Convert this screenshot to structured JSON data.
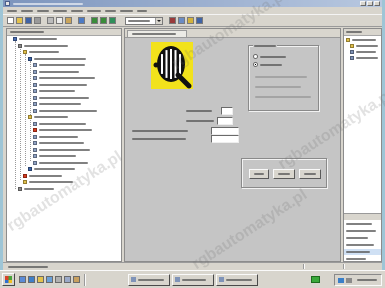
{
  "watermark": {
    "text": "rgbautomatyka.pl"
  },
  "colors": {
    "desktop_frame": "#9ec5d6",
    "title_bar": "#7d95bd",
    "chrome": "#d8d5cd",
    "editor_bg": "#c5c5c5",
    "safety_icon_yellow": "#f2e21c",
    "status_green": "#3aa83a",
    "tree_warning_icon": "#d83a1e"
  },
  "toolbar": {
    "icons_left": [
      "new-document-icon",
      "open-folder-icon",
      "save-icon",
      "print-icon",
      "cut-icon",
      "copy-icon",
      "paste-icon",
      "undo-icon",
      "download-icon",
      "upload-icon",
      "go-online-icon"
    ],
    "icons_right": [
      "go-offline-icon",
      "zoom-icon",
      "diagnostics-icon",
      "help-icon"
    ]
  },
  "tree": {
    "items": [
      {
        "level": 0,
        "icon": "project-icon"
      },
      {
        "level": 1,
        "icon": "station-icon"
      },
      {
        "level": 2,
        "icon": "folder-icon"
      },
      {
        "level": 3,
        "icon": "device-icon"
      },
      {
        "level": 4,
        "icon": "module-icon"
      },
      {
        "level": 4,
        "icon": "module-icon"
      },
      {
        "level": 4,
        "icon": "module-icon"
      },
      {
        "level": 4,
        "icon": "module-icon"
      },
      {
        "level": 4,
        "icon": "module-icon"
      },
      {
        "level": 4,
        "icon": "module-icon"
      },
      {
        "level": 4,
        "icon": "module-icon"
      },
      {
        "level": 4,
        "icon": "module-icon"
      },
      {
        "level": 3,
        "icon": "folder-icon"
      },
      {
        "level": 4,
        "icon": "module-icon"
      },
      {
        "level": 4,
        "icon": "module-error-icon"
      },
      {
        "level": 4,
        "icon": "module-icon"
      },
      {
        "level": 4,
        "icon": "module-icon"
      },
      {
        "level": 4,
        "icon": "module-icon"
      },
      {
        "level": 4,
        "icon": "module-icon"
      },
      {
        "level": 4,
        "icon": "module-icon"
      },
      {
        "level": 3,
        "icon": "device-icon"
      },
      {
        "level": 2,
        "icon": "module-error-icon"
      },
      {
        "level": 2,
        "icon": "folder-icon"
      },
      {
        "level": 1,
        "icon": "station-icon"
      }
    ]
  },
  "catalog": {
    "items": [
      {
        "level": 0,
        "icon": "catalog-folder-icon"
      },
      {
        "level": 1,
        "icon": "catalog-folder-icon"
      },
      {
        "level": 1,
        "icon": "catalog-device-icon"
      },
      {
        "level": 1,
        "icon": "catalog-device-icon"
      }
    ]
  },
  "editor": {
    "device_icon": "safety-device-icon"
  },
  "taskbar": {
    "start_icon": "start-icon",
    "quick_launch_icons": [
      "desktop-icon",
      "browser-icon",
      "explorer-icon",
      "mail-icon",
      "app-icon",
      "app-icon",
      "app-icon"
    ],
    "tray_icons": [
      "network-icon",
      "volume-icon"
    ],
    "status_icon": "status-green-icon"
  }
}
